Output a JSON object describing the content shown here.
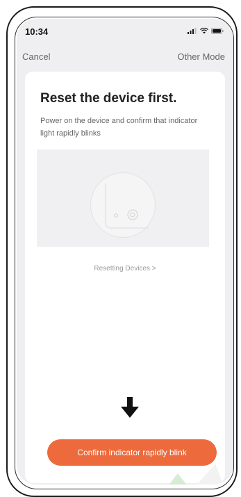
{
  "status_bar": {
    "time": "10:34",
    "icons": [
      "signal-icon",
      "wifi-icon",
      "battery-icon"
    ]
  },
  "nav": {
    "cancel_label": "Cancel",
    "other_mode_label": "Other Mode"
  },
  "card": {
    "title": "Reset the device first.",
    "description": "Power on the device and confirm that indicator light rapidly blinks",
    "resetting_link": "Resetting Devices >"
  },
  "confirm_button": {
    "label": "Confirm indicator rapidly blink"
  },
  "colors": {
    "accent": "#ec6a3c",
    "screen_background": "#efeff1",
    "card_background": "#ffffff"
  }
}
